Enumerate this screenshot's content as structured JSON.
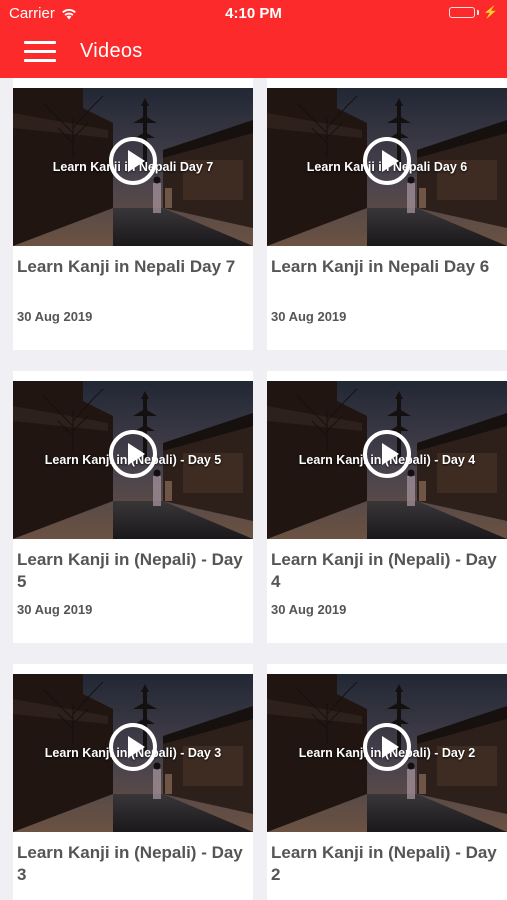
{
  "status_bar": {
    "carrier": "Carrier",
    "time": "4:10 PM"
  },
  "navbar": {
    "title": "Videos",
    "menu_icon": "hamburger-menu-icon"
  },
  "colors": {
    "accent": "#fc2a2a",
    "background": "#efeff4",
    "card_text": "#555555"
  },
  "videos": [
    {
      "overlay": "Learn Kanji in Nepali Day 7",
      "title": "Learn Kanji in Nepali Day 7",
      "date": "30 Aug 2019"
    },
    {
      "overlay": "Learn Kanji in Nepali Day 6",
      "title": "Learn Kanji in Nepali Day 6",
      "date": "30 Aug 2019"
    },
    {
      "overlay": "Learn Kanji in (Nepali) - Day 5",
      "title": "Learn Kanji in (Nepali) - Day 5",
      "date": "30 Aug 2019"
    },
    {
      "overlay": "Learn Kanji in (Nepali) - Day 4",
      "title": "Learn Kanji in (Nepali) - Day 4",
      "date": "30 Aug 2019"
    },
    {
      "overlay": "Learn Kanji in (Nepali) - Day 3",
      "title": "Learn Kanji in (Nepali) - Day 3",
      "date": ""
    },
    {
      "overlay": "Learn Kanji in (Nepali) - Day 2",
      "title": "Learn Kanji in (Nepali) - Day 2",
      "date": ""
    }
  ]
}
